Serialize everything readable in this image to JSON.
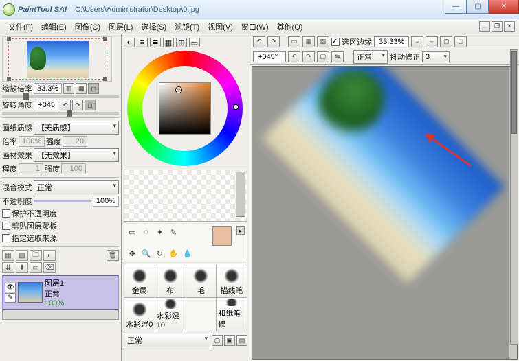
{
  "titlebar": {
    "app_name": "PaintTool SAI",
    "file_path": "C:\\Users\\Administrator\\Desktop\\0.jpg"
  },
  "menu": [
    "文件(F)",
    "编辑(E)",
    "图像(C)",
    "图层(L)",
    "选择(S)",
    "滤镜(T)",
    "视图(V)",
    "窗口(W)",
    "其他(O)"
  ],
  "left": {
    "zoom_label": "缩放倍率",
    "zoom_value": "33.3%",
    "rotate_label": "旋转角度",
    "rotate_value": "+045",
    "paper_tex_label": "画纸质感",
    "paper_tex_value": "【无质感】",
    "scale_label": "倍率",
    "scale_value": "100%",
    "strength_label": "强度",
    "strength_value": "20",
    "brush_tex_label": "画材效果",
    "brush_tex_value": "【无效果】",
    "amount_label": "程度",
    "amount_value": "1",
    "strength2_label": "强度",
    "strength2_value": "100",
    "blend_label": "混合模式",
    "blend_value": "正常",
    "opacity_label": "不透明度",
    "opacity_value": "100%",
    "preserve_opacity": "保护不透明度",
    "clipping": "剪贴图层蒙板",
    "select_source": "指定选取来源",
    "layer": {
      "name": "图层1",
      "mode": "正常",
      "opacity": "100%"
    }
  },
  "brushes": [
    "金属",
    "布",
    "毛",
    "描线笔",
    "水彩混0",
    "水彩混10",
    "",
    "和纸笔修"
  ],
  "brush_mode": "正常",
  "canvas_top": {
    "sel_edge_label": "选区边缘",
    "zoom": "33.33%",
    "angle": "+045°",
    "stabilizer_mode": "正常",
    "shake_label": "抖动修正",
    "shake_value": "3"
  }
}
